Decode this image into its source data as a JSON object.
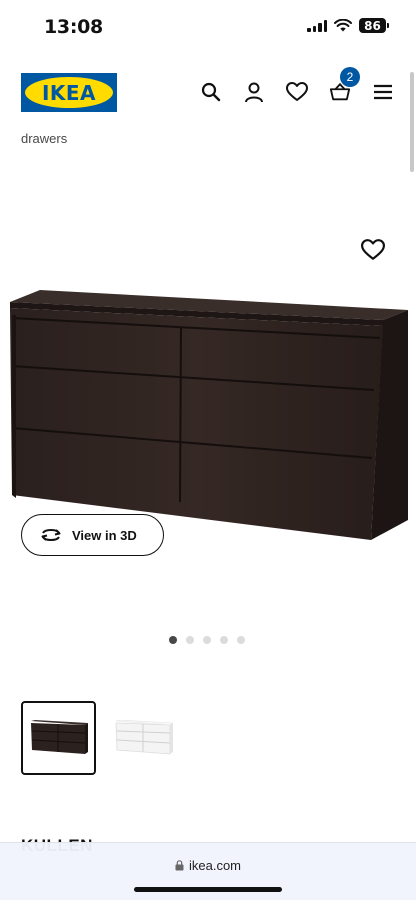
{
  "status_bar": {
    "time": "13:08",
    "battery": "86",
    "icons": [
      "signal-icon",
      "wifi-icon",
      "battery-icon"
    ]
  },
  "header": {
    "logo_text": "IKEA",
    "icons": [
      "search-icon",
      "user-icon",
      "heart-icon",
      "cart-icon",
      "menu-icon"
    ],
    "cart_count": "2"
  },
  "product": {
    "subtitle_fragment": "drawers",
    "next_title_fragment": "KULLEN"
  },
  "gallery": {
    "view3d_label": "View in 3D",
    "slide_count": 5,
    "active_slide": 1,
    "thumbnails": [
      "black-brown",
      "white"
    ]
  },
  "browser": {
    "url": "ikea.com"
  },
  "colors": {
    "brand_blue": "#0058a3",
    "brand_yellow": "#ffdb00",
    "dresser_dark": "#2b211e",
    "dot_inactive": "#dcdcdc",
    "dot_active": "#484848"
  }
}
